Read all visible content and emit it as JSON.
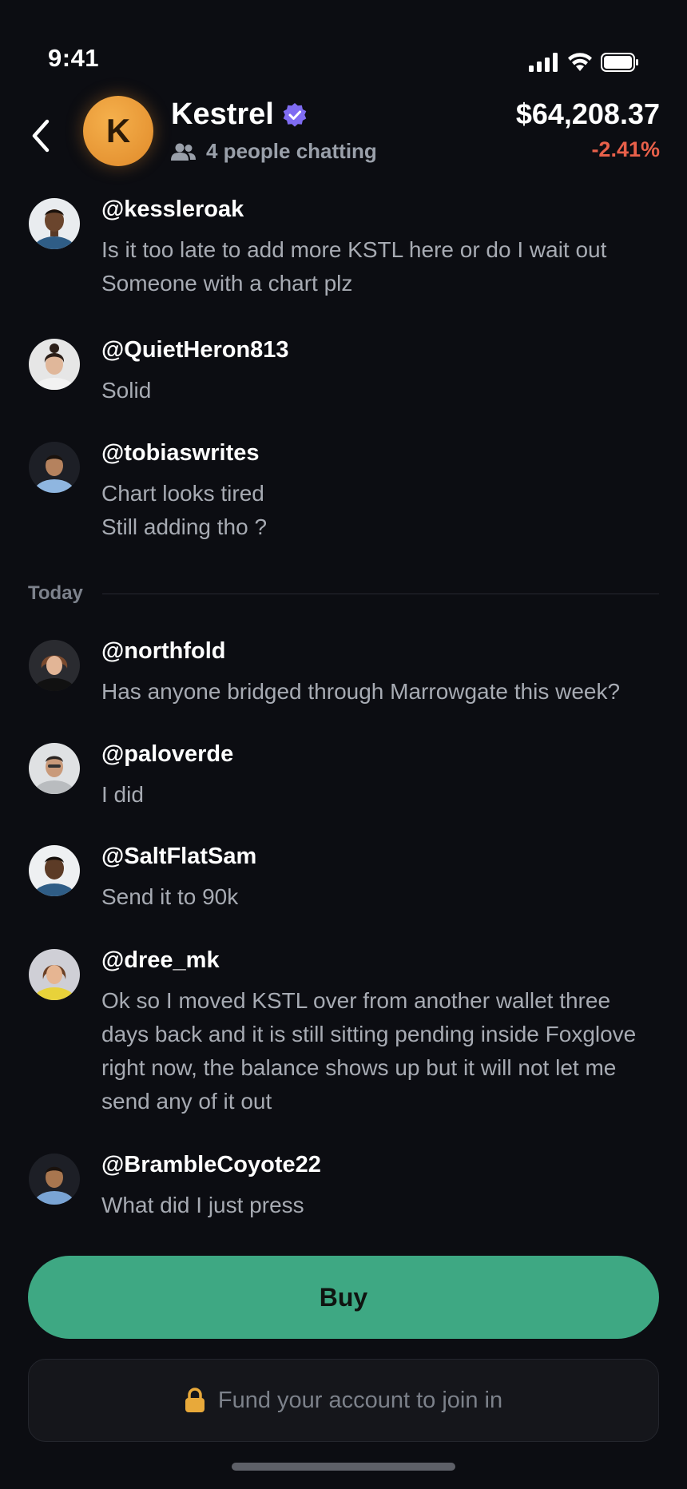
{
  "status_bar": {
    "time": "9:41",
    "icons": [
      "signal-icon",
      "wifi-icon",
      "battery-icon"
    ]
  },
  "header": {
    "back_icon": "chevron-left-icon",
    "token_initial": "K",
    "token_name": "Kestrel",
    "verified_icon": "verified-badge-icon",
    "people_icon": "people-icon",
    "chatting_text": "4 people chatting",
    "price": "$64,208.37",
    "change": "-2.41%",
    "change_color": "#e8604a",
    "accent": "#3ea883"
  },
  "messages": [
    {
      "handle": "@kessleroak",
      "text": "Is it too late to add more KSTL here or do I wait out\nSomeone with a chart plz"
    },
    {
      "handle": "@QuietHeron813",
      "text": "Solid"
    },
    {
      "handle": "@tobiaswrites",
      "text": "Chart looks tired\nStill adding tho ?"
    },
    {
      "handle": "@northfold",
      "text": "Has anyone bridged through Marrowgate this week?"
    },
    {
      "handle": "@paloverde",
      "text": "I did"
    },
    {
      "handle": "@SaltFlatSam",
      "text": "Send it to 90k"
    },
    {
      "handle": "@dree_mk",
      "text": "Ok so I moved KSTL over from another wallet three days back and it is still sitting pending inside Foxglove right now, the balance shows up but it will not let me send any of it out"
    },
    {
      "handle": "@BrambleCoyote22",
      "text": "What did I just press"
    }
  ],
  "divider_label": "Today",
  "actions": {
    "buy_label": "Buy",
    "fund_label": "Fund your account to join in",
    "lock_icon": "lock-icon"
  }
}
